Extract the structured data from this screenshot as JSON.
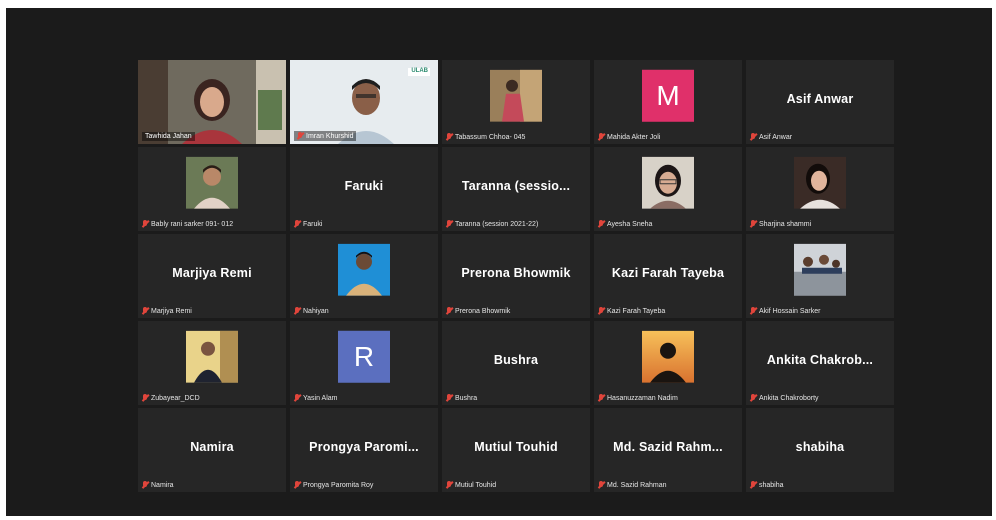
{
  "tiles": [
    {
      "label": "Tawhida Jahan",
      "speaking": true,
      "video": "woman"
    },
    {
      "label": "Imran Khurshid",
      "video": "man",
      "mic_muted": true,
      "logo_text": "ULAB"
    },
    {
      "label": "Tabassum Chhoa- 045",
      "mic_muted": true,
      "photo": "photo-a"
    },
    {
      "label": "Mahida Akter Joli",
      "mic_muted": true,
      "letter": "M",
      "letter_color": "#e0306a"
    },
    {
      "label": "Asif Anwar",
      "mic_muted": true,
      "name": "Asif Anwar"
    },
    {
      "label": "Bably rani sarker 091- 012",
      "mic_muted": true,
      "photo": "photo-b"
    },
    {
      "label": "Faruki",
      "mic_muted": true,
      "name": "Faruki"
    },
    {
      "label": "Taranna (session 2021-22)",
      "mic_muted": true,
      "name": "Taranna  (sessio..."
    },
    {
      "label": "Ayesha Sneha",
      "mic_muted": true,
      "photo": "photo-c"
    },
    {
      "label": "Sharjina shammi",
      "mic_muted": true,
      "photo": "photo-d"
    },
    {
      "label": "Marjiya Remi",
      "mic_muted": true,
      "name": "Marjiya Remi"
    },
    {
      "label": "Nahiyan",
      "mic_muted": true,
      "photo": "photo-e"
    },
    {
      "label": "Prerona Bhowmik",
      "mic_muted": true,
      "name": "Prerona Bhowmik"
    },
    {
      "label": "Kazi Farah Tayeba",
      "mic_muted": true,
      "name": "Kazi Farah Tayeba"
    },
    {
      "label": "Akif Hossain Sarker",
      "mic_muted": true,
      "photo": "photo-f"
    },
    {
      "label": "Zubayear_DCD",
      "mic_muted": true,
      "photo": "photo-g"
    },
    {
      "label": "Yasin Alam",
      "mic_muted": true,
      "letter": "R",
      "letter_color": "#5b6fbf"
    },
    {
      "label": "Bushra",
      "mic_muted": true,
      "name": "Bushra"
    },
    {
      "label": "Hasanuzzaman Nadim",
      "mic_muted": true,
      "photo": "photo-h"
    },
    {
      "label": "Ankita Chakroborty",
      "mic_muted": true,
      "name": "Ankita  Chakrob..."
    },
    {
      "label": "Namira",
      "mic_muted": true,
      "name": "Namira"
    },
    {
      "label": "Prongya Paromita Roy",
      "mic_muted": true,
      "name": "Prongya  Paromi..."
    },
    {
      "label": "Mutiul Touhid",
      "mic_muted": true,
      "name": "Mutiul Touhid"
    },
    {
      "label": "Md. Sazid Rahman",
      "mic_muted": true,
      "name": "Md.  Sazid  Rahm..."
    },
    {
      "label": "shabiha",
      "mic_muted": true,
      "name": "shabiha"
    }
  ]
}
